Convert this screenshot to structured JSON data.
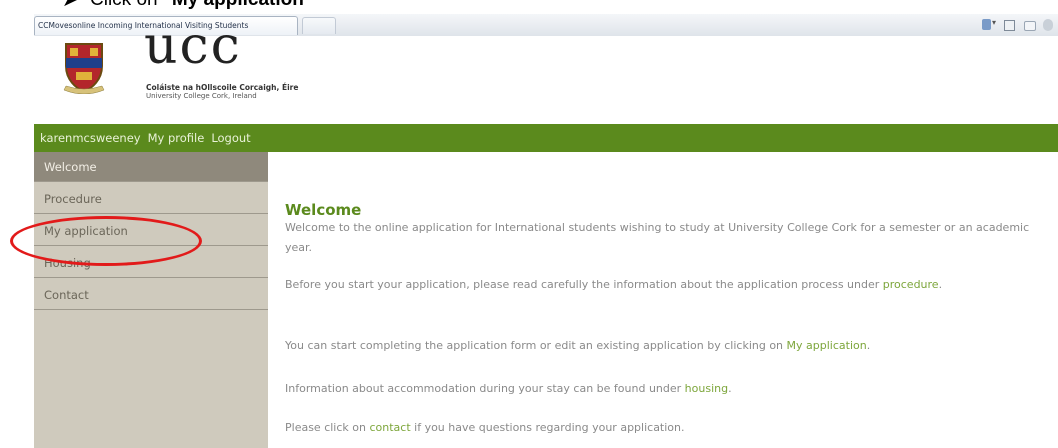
{
  "instruction": {
    "bullet": "➤",
    "prefix": "Click on ",
    "target": "\"My application\""
  },
  "browser": {
    "tab_title": "CCMovesonline Incoming International Visiting Students",
    "icons": [
      "home-icon",
      "feeds-icon",
      "print-icon",
      "page-icon"
    ]
  },
  "header": {
    "logo_word": "ucc",
    "irish_name": "Coláiste na hOllscoile Corcaigh, Éire",
    "english_name": "University College Cork, Ireland"
  },
  "nav": {
    "username": "karenmcsweeney",
    "profile": "My profile",
    "logout": "Logout"
  },
  "sidebar": {
    "items": [
      {
        "label": "Welcome"
      },
      {
        "label": "Procedure"
      },
      {
        "label": "My application"
      },
      {
        "label": "Housing"
      },
      {
        "label": "Contact"
      }
    ],
    "active_index": 0
  },
  "main": {
    "heading": "Welcome",
    "p1": "Welcome to the online application for International students wishing to study at University College Cork for a semester or an academic year.",
    "p2_text": "Before you start your application, please read carefully the information about the application process under ",
    "p2_link": "procedure",
    "p2_end": ".",
    "p3_text": "You can start completing the application form or edit an existing application by clicking on ",
    "p3_link": "My application",
    "p3_end": ".",
    "p4_text": "Information about accommodation during your stay can be found under ",
    "p4_link": "housing",
    "p4_end": ".",
    "p5_text": "Please click on ",
    "p5_link": "contact",
    "p5_end": " if you have questions regarding your application."
  },
  "colors": {
    "nav_green": "#5b8a1d",
    "sidebar_bg": "#cfcabd",
    "active_item": "#8f897c",
    "highlight_red": "#e21a1a"
  }
}
